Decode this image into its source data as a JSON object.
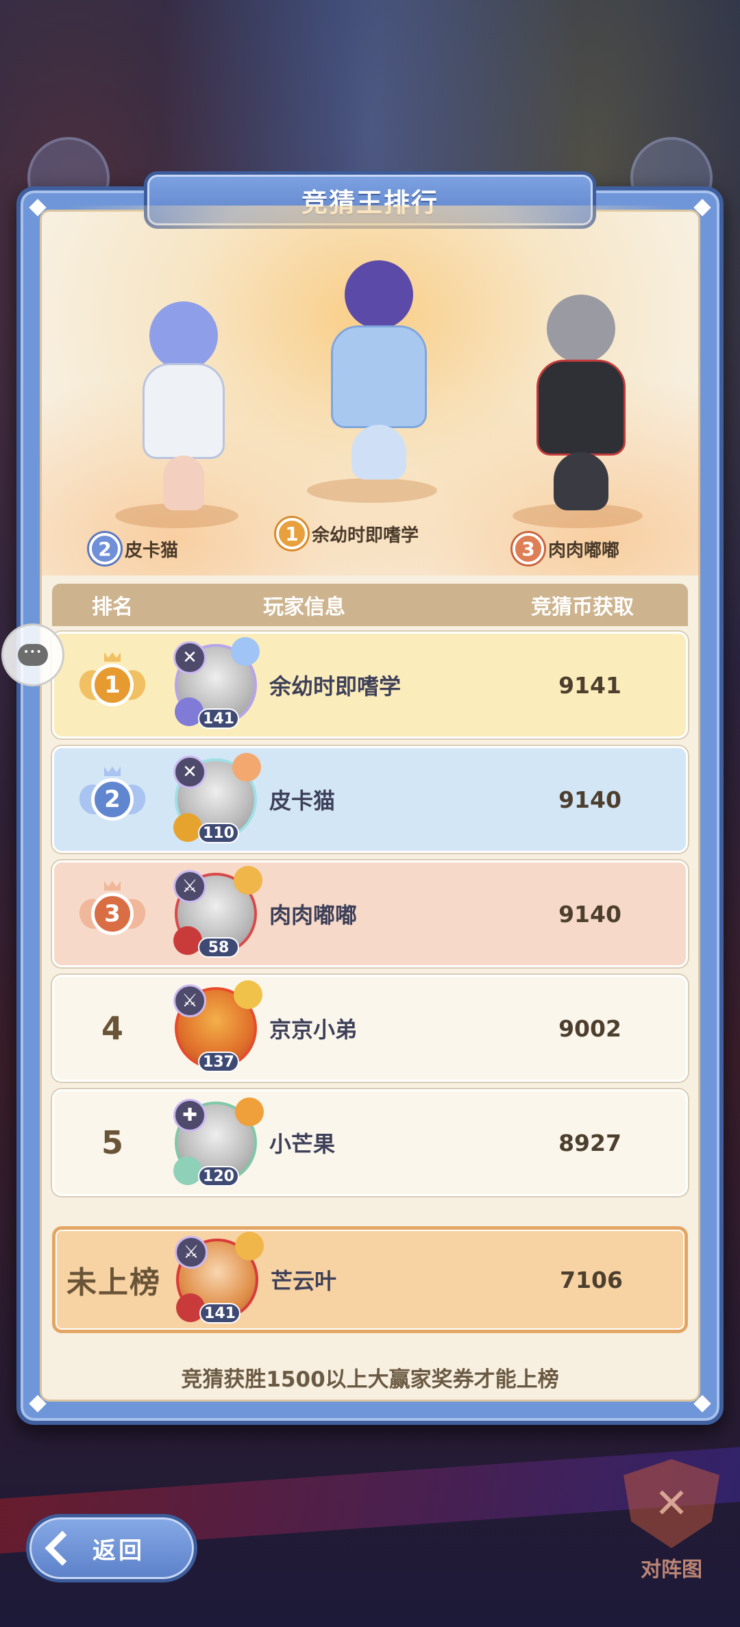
{
  "header": {
    "title": "竞猜王排行"
  },
  "podium": [
    {
      "rank": "2",
      "name": "皮卡猫"
    },
    {
      "rank": "1",
      "name": "余幼时即嗜学"
    },
    {
      "rank": "3",
      "name": "肉肉嘟嘟"
    }
  ],
  "table": {
    "columns": [
      "排名",
      "玩家信息",
      "竞猜币获取"
    ],
    "rows": [
      {
        "rank": "1",
        "name": "余幼时即嗜学",
        "level": "141",
        "score": "9141"
      },
      {
        "rank": "2",
        "name": "皮卡猫",
        "level": "110",
        "score": "9140"
      },
      {
        "rank": "3",
        "name": "肉肉嘟嘟",
        "level": "58",
        "score": "9140"
      },
      {
        "rank": "4",
        "name": "京京小弟",
        "level": "137",
        "score": "9002"
      },
      {
        "rank": "5",
        "name": "小芒果",
        "level": "120",
        "score": "8927"
      }
    ],
    "self": {
      "rank_text": "未上榜",
      "name": "芒云叶",
      "level": "141",
      "score": "7106"
    }
  },
  "footer_note": "竞猜获胜1500以上大赢家奖券才能上榜",
  "buttons": {
    "back": "返回",
    "lineup": "对阵图"
  },
  "icons": {
    "back": "chevron-left-icon",
    "chat": "chat-bubble-icon",
    "lineup": "crossed-swords-icon",
    "class": "crossed-weapon-icon"
  },
  "colors": {
    "panel_blue": "#6f96d8",
    "panel_cream": "#f7efdf",
    "rank1": "#fbedbb",
    "rank2": "#d3e6f6",
    "rank3": "#f6d9c8",
    "self_row": "#f7d2a3"
  }
}
